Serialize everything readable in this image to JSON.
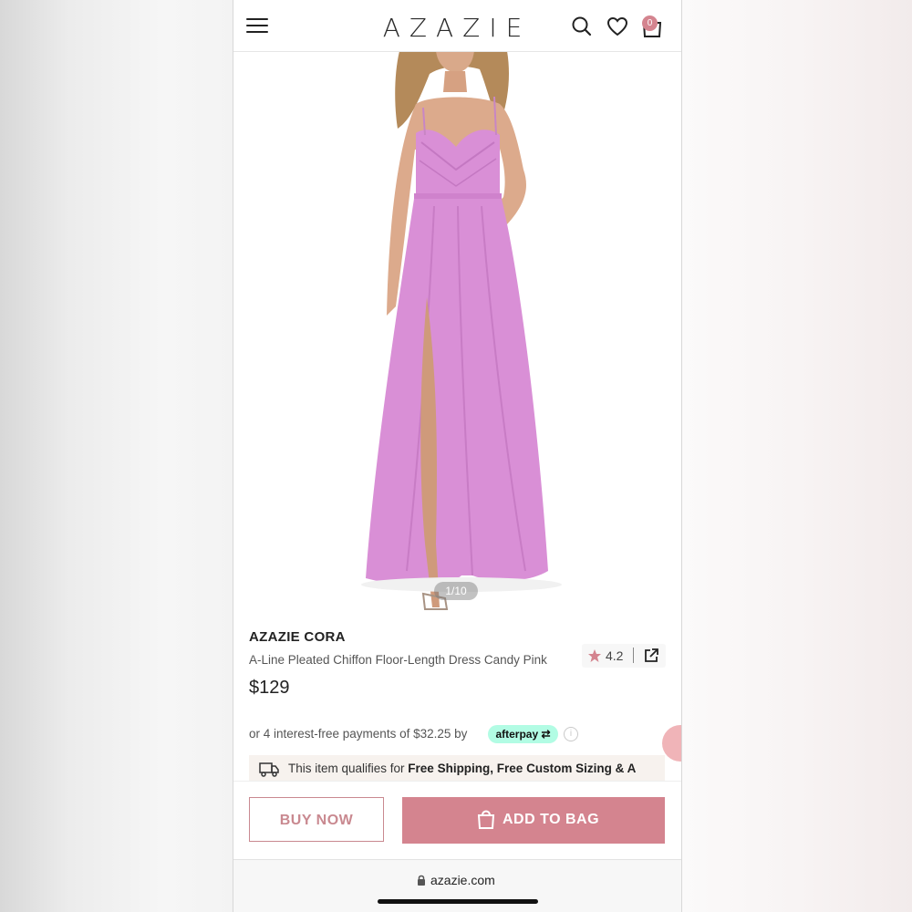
{
  "header": {
    "logo": "AZAZIE",
    "cart_count": "0"
  },
  "gallery": {
    "counter": "1/10"
  },
  "product": {
    "brand": "AZAZIE CORA",
    "name": "A-Line Pleated Chiffon Floor-Length Dress Candy Pink",
    "price": "$129",
    "rating": "4.2"
  },
  "payment": {
    "text": "or 4 interest-free payments of $32.25 by",
    "provider": "afterpay",
    "info_icon": "i"
  },
  "shipping": {
    "prefix": "This item qualifies for ",
    "highlight": "Free Shipping, Free Custom Sizing & A"
  },
  "actions": {
    "buy_now": "BUY NOW",
    "add_to_bag": "ADD TO BAG"
  },
  "browser": {
    "url": "azazie.com"
  },
  "colors": {
    "accent": "#d4848f",
    "afterpay": "#b2fce4",
    "dress": "#d98fd6"
  },
  "icons": [
    "menu-icon",
    "search-icon",
    "heart-icon",
    "bag-icon",
    "star-icon",
    "share-icon",
    "info-icon",
    "chat-icon",
    "truck-icon",
    "lock-icon"
  ]
}
